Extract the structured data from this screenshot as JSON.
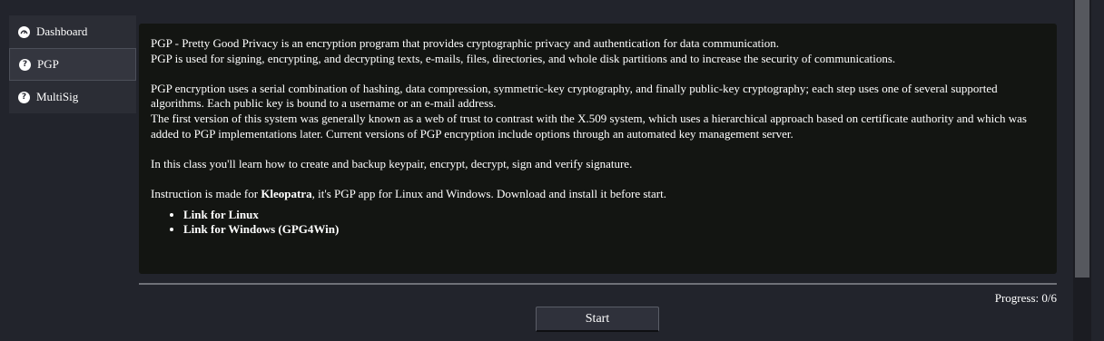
{
  "sidebar": {
    "items": [
      {
        "label": "Dashboard",
        "icon": "dashboard-icon",
        "active": false
      },
      {
        "label": "PGP",
        "icon": "question-icon",
        "active": true
      },
      {
        "label": "MultiSig",
        "icon": "question-icon",
        "active": false
      }
    ]
  },
  "content": {
    "para1_line1": "PGP - Pretty Good Privacy is an encryption program that provides cryptographic privacy and authentication for data communication.",
    "para1_line2": "PGP is used for signing, encrypting, and decrypting texts, e-mails, files, directories, and whole disk partitions and to increase the security of communications.",
    "para2_line1": "PGP encryption uses a serial combination of hashing, data compression, symmetric-key cryptography, and finally public-key cryptography; each step uses one of several supported algorithms. Each public key is bound to a username or an e-mail address.",
    "para2_line2": "The first version of this system was generally known as a web of trust to contrast with the X.509 system, which uses a hierarchical approach based on certificate authority and which was added to PGP implementations later. Current versions of PGP encryption include options through an automated key management server.",
    "para3": "In this class you'll learn how to create and backup keypair, encrypt, decrypt, sign and verify signature.",
    "instruction_prefix": "Instruction is made for ",
    "instruction_app": "Kleopatra",
    "instruction_suffix": ", it's PGP app for Linux and Windows. Download and install it before start.",
    "links": [
      "Link for Linux",
      "Link for Windows (GPG4Win)"
    ]
  },
  "footer": {
    "progress": "Progress: 0/6",
    "start_label": "Start"
  },
  "colors": {
    "background": "#22242c",
    "panel": "#131512",
    "text": "#ffffff"
  }
}
